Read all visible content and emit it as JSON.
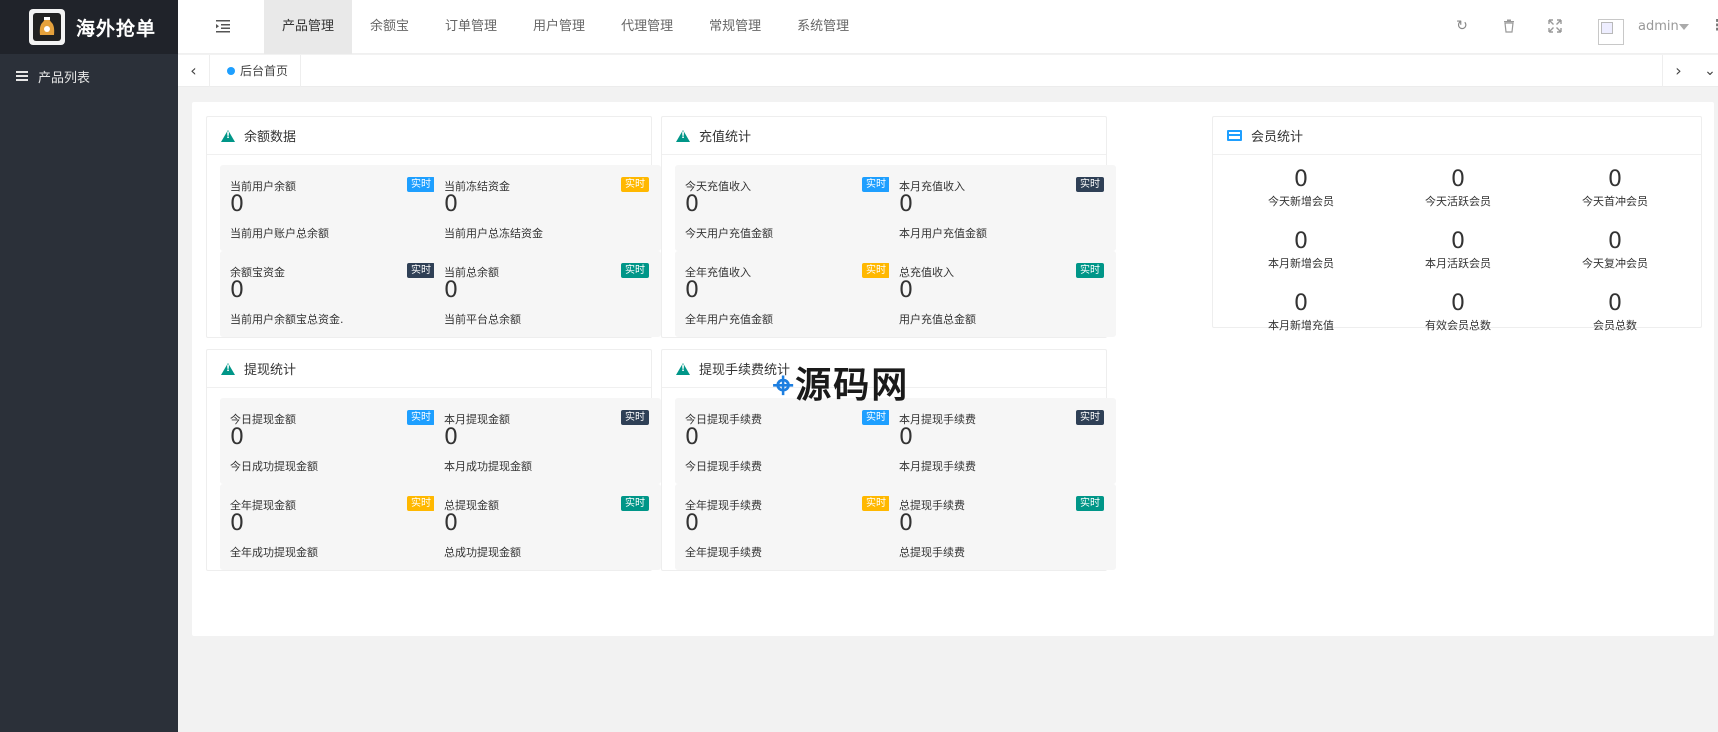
{
  "brand": {
    "name": "海外抢单"
  },
  "sidebar": {
    "items": [
      {
        "label": "产品列表"
      }
    ]
  },
  "header": {
    "nav": [
      "产品管理",
      "余额宝",
      "订单管理",
      "用户管理",
      "代理管理",
      "常规管理",
      "系统管理"
    ],
    "active_index": 0,
    "user": "admin"
  },
  "tabs": {
    "home": "后台首页"
  },
  "watermark": "源码网",
  "sections": {
    "balance": {
      "title": "余额数据",
      "cells": [
        {
          "title": "当前用户余额",
          "badge": "实时",
          "badge_color": "#1e9fff",
          "value": "0",
          "desc": "当前用户账户总余额"
        },
        {
          "title": "当前冻结资金",
          "badge": "实时",
          "badge_color": "#ffb800",
          "value": "0",
          "desc": "当前用户总冻结资金"
        },
        {
          "title": "余额宝资金",
          "badge": "实时",
          "badge_color": "#2f4056",
          "value": "0",
          "desc": "当前用户余额宝总资金."
        },
        {
          "title": "当前总余额",
          "badge": "实时",
          "badge_color": "#009688",
          "value": "0",
          "desc": "当前平台总余额"
        }
      ]
    },
    "recharge": {
      "title": "充值统计",
      "cells": [
        {
          "title": "今天充值收入",
          "badge": "实时",
          "badge_color": "#1e9fff",
          "value": "0",
          "desc": "今天用户充值金额"
        },
        {
          "title": "本月充值收入",
          "badge": "实时",
          "badge_color": "#2f4056",
          "value": "0",
          "desc": "本月用户充值金额"
        },
        {
          "title": "全年充值收入",
          "badge": "实时",
          "badge_color": "#ffb800",
          "value": "0",
          "desc": "全年用户充值金额"
        },
        {
          "title": "总充值收入",
          "badge": "实时",
          "badge_color": "#009688",
          "value": "0",
          "desc": "用户充值总金额"
        }
      ]
    },
    "withdraw": {
      "title": "提现统计",
      "cells": [
        {
          "title": "今日提现金额",
          "badge": "实时",
          "badge_color": "#1e9fff",
          "value": "0",
          "desc": "今日成功提现金额"
        },
        {
          "title": "本月提现金额",
          "badge": "实时",
          "badge_color": "#2f4056",
          "value": "0",
          "desc": "本月成功提现金额"
        },
        {
          "title": "全年提现金额",
          "badge": "实时",
          "badge_color": "#ffb800",
          "value": "0",
          "desc": "全年成功提现金额"
        },
        {
          "title": "总提现金额",
          "badge": "实时",
          "badge_color": "#009688",
          "value": "0",
          "desc": "总成功提现金额"
        }
      ]
    },
    "fee": {
      "title": "提现手续费统计",
      "cells": [
        {
          "title": "今日提现手续费",
          "badge": "实时",
          "badge_color": "#1e9fff",
          "value": "0",
          "desc": "今日提现手续费"
        },
        {
          "title": "本月提现手续费",
          "badge": "实时",
          "badge_color": "#2f4056",
          "value": "0",
          "desc": "本月提现手续费"
        },
        {
          "title": "全年提现手续费",
          "badge": "实时",
          "badge_color": "#ffb800",
          "value": "0",
          "desc": "全年提现手续费"
        },
        {
          "title": "总提现手续费",
          "badge": "实时",
          "badge_color": "#009688",
          "value": "0",
          "desc": "总提现手续费"
        }
      ]
    },
    "members": {
      "title": "会员统计",
      "items": [
        {
          "value": "0",
          "label": "今天新增会员"
        },
        {
          "value": "0",
          "label": "今天活跃会员"
        },
        {
          "value": "0",
          "label": "今天首冲会员"
        },
        {
          "value": "0",
          "label": "本月新增会员"
        },
        {
          "value": "0",
          "label": "本月活跃会员"
        },
        {
          "value": "0",
          "label": "今天复冲会员"
        },
        {
          "value": "0",
          "label": "本月新增充值"
        },
        {
          "value": "0",
          "label": "有效会员总数"
        },
        {
          "value": "0",
          "label": "会员总数"
        }
      ]
    }
  }
}
